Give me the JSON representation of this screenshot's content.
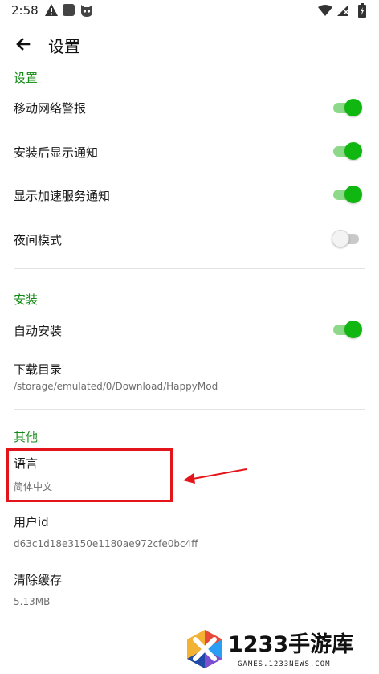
{
  "status_bar": {
    "time": "2:58",
    "left_icons": [
      "warning-icon",
      "square-app-icon",
      "cat-face-icon"
    ],
    "right_icons": [
      "wifi-icon",
      "signal-icon",
      "battery-icon"
    ]
  },
  "app_bar": {
    "title": "设置",
    "back_icon": "arrow-back-icon"
  },
  "sections": {
    "settings": {
      "header": "设置",
      "items": [
        {
          "title": "移动网络警报",
          "toggle": true
        },
        {
          "title": "安装后显示通知",
          "toggle": true
        },
        {
          "title": "显示加速服务通知",
          "toggle": true
        },
        {
          "title": "夜间模式",
          "toggle": false
        }
      ]
    },
    "install": {
      "header": "安装",
      "auto_install": {
        "title": "自动安装",
        "toggle": true
      },
      "download_dir": {
        "title": "下载目录",
        "summary": "/storage/emulated/0/Download/HappyMod"
      }
    },
    "other": {
      "header": "其他",
      "language": {
        "title": "语言",
        "summary": "简体中文"
      },
      "user_id": {
        "title": "用户id",
        "summary": "d63c1d18e3150e1180ae972cfe0bc4ff"
      },
      "clear_cache": {
        "title": "清除缓存",
        "summary": "5.13MB"
      }
    }
  },
  "colors": {
    "accent_green": "#0f8a12",
    "toggle_on": "#11b711",
    "toggle_track_on": "#8ed989",
    "highlight_red": "#e4141b"
  },
  "watermark": {
    "name": "1233手游库",
    "url": "GAMES.1233NEWS.COM"
  }
}
